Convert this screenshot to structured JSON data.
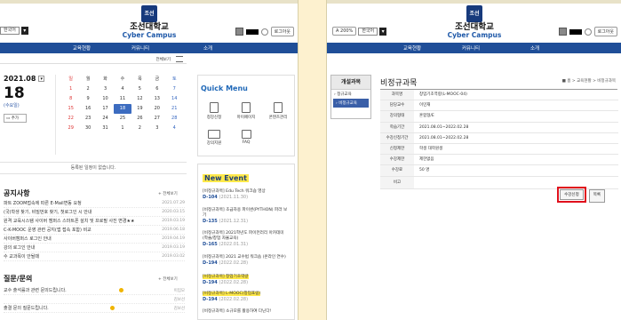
{
  "left": {
    "logo": {
      "title": "조선대학교",
      "subtitle": "Cyber Campus",
      "emblem": "조선"
    },
    "lang_select": "한국어",
    "util": {
      "logout": "로그아웃"
    },
    "gnb": [
      "교육현황",
      "커뮤니티",
      "소개"
    ],
    "calendar": {
      "more": "전체보기",
      "year_month": "2021.08",
      "day": "18",
      "weekday": "(수요일)",
      "add_label": "추가",
      "weekdays": [
        "일",
        "월",
        "화",
        "수",
        "목",
        "금",
        "토"
      ],
      "weeks": [
        [
          "1",
          "2",
          "3",
          "4",
          "5",
          "6",
          "7"
        ],
        [
          "8",
          "9",
          "10",
          "11",
          "12",
          "13",
          "14"
        ],
        [
          "15",
          "16",
          "17",
          "18",
          "19",
          "20",
          "21"
        ],
        [
          "22",
          "23",
          "24",
          "25",
          "26",
          "27",
          "28"
        ],
        [
          "29",
          "30",
          "31",
          "1",
          "2",
          "3",
          "4"
        ]
      ],
      "empty": "등록된 일정이 없습니다."
    },
    "notice": {
      "title": "공지사항",
      "more": "+ 전체보기",
      "items": [
        {
          "t": "파트 ZOOM접속에 따른 E-Mail변동 요청",
          "d": "2021.07.29"
        },
        {
          "t": "(국)학생 찾기, 비밀번호 찾기, 첫로그인 시 안내",
          "d": "2020.03.15"
        },
        {
          "t": "원격 교육시스템 사이버 캠퍼스 스마트폰 설치 및 프로필 사진 변경★★",
          "d": "2019.03.19"
        },
        {
          "t": "C-K-MOOC 운영 관련 공지(앱 접속 포함) 비교",
          "d": "2019.06.18"
        },
        {
          "t": "사이버캠퍼스 로그인 안내",
          "d": "2019.04.19"
        },
        {
          "t": "강의 로그인 안내",
          "d": "2019.03.19"
        },
        {
          "t": "수 교과목이 안될때",
          "d": "2019.03.02"
        }
      ]
    },
    "qna": {
      "title": "질문/문의",
      "more": "+ 전체보기",
      "items": [
        {
          "t": "교수 출석률과 관련 문의드립니다.",
          "d": "이입모"
        },
        {
          "t": "",
          "d": "김보선"
        },
        {
          "t": "출결 문의 질문드립니다.",
          "d": "김보선"
        }
      ]
    },
    "quick_menu": {
      "title": "Quick Menu",
      "items": [
        "청강신청",
        "마이페이지",
        "콘텐츠관리",
        "강의지원",
        "FAQ"
      ]
    },
    "events": {
      "title": "New Event",
      "items": [
        {
          "n": "[비정규과목] Edu Tech 워크숍 영상",
          "d": "D-104",
          "date": "(2021.11.30)"
        },
        {
          "n": "[비정규과목] 초급자용 파이썬(PYTHON) 파라 보기",
          "d": "D-135",
          "date": "(2021.12.31)"
        },
        {
          "n": "[비정규과목] 2021학년도 파이먼러리 아카데미 (학술/창업 자율교육)",
          "d": "D-165",
          "date": "(2022.01.31)"
        },
        {
          "n": "[비정규과목] 2021 교수법 워크숍 (온라인 연수)",
          "d": "D-194",
          "date": "(2022.02.28)"
        },
        {
          "n": "[비정규과목] 창업기초역량",
          "d": "D-194",
          "date": "(2022.02.28)"
        },
        {
          "n": "[비정규과목] L-MOOC(창업포럼)",
          "d": "D-194",
          "date": "(2022.02.28)"
        },
        {
          "n": "[비정규과목] 소규모를 활용하여 다닌다!",
          "d": "",
          "date": ""
        }
      ]
    }
  },
  "right": {
    "logo": {
      "title": "조선대학교",
      "subtitle": "Cyber Campus",
      "emblem": "조선"
    },
    "lang_select": "한국어",
    "util": {
      "logout": "로그아웃",
      "small_btn": "A 200%"
    },
    "gnb": [
      "교육현황",
      "커뮤니티",
      "소개"
    ],
    "side": {
      "title": "개설과목",
      "items": [
        "정규교육",
        "비정규교육"
      ]
    },
    "page_title": "비정규과목",
    "breadcrumb": "홈 > 교육현황 > 비정규과목",
    "info": [
      {
        "k": "과목명",
        "v": "창업기초역량(L-MOOC-04)"
      },
      {
        "k": "담당교수",
        "v": "이민재"
      },
      {
        "k": "강의형태",
        "v": "혼합형/E"
      },
      {
        "k": "학습기간",
        "v": "2021.08.01~2022.02.28"
      },
      {
        "k": "수강신청기간",
        "v": "2021.08.01~2022.02.28"
      },
      {
        "k": "신청제한",
        "v": "학생 대학원생"
      },
      {
        "k": "수강제한",
        "v": "제한없음"
      },
      {
        "k": "수강료",
        "v": "50 명"
      },
      {
        "k": "비고",
        "v": ""
      }
    ],
    "buttons": {
      "apply": "수강신청",
      "list": "목록"
    }
  }
}
